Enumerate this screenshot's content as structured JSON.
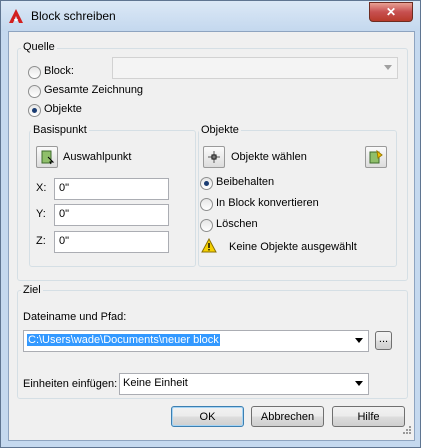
{
  "window": {
    "title": "Block schreiben",
    "close_glyph": "✕"
  },
  "source": {
    "group_label": "Quelle",
    "block_label": "Block:",
    "block_value": "",
    "drawing_label": "Gesamte Zeichnung",
    "objects_label": "Objekte",
    "selected": "Objekte"
  },
  "basepoint": {
    "group_label": "Basispunkt",
    "pick_label": "Auswahlpunkt",
    "x_label": "X:",
    "x_value": "0\"",
    "y_label": "Y:",
    "y_value": "0\"",
    "z_label": "Z:",
    "z_value": "0\""
  },
  "objects": {
    "group_label": "Objekte",
    "select_label": "Objekte wählen",
    "retain_label": "Beibehalten",
    "convert_label": "In Block konvertieren",
    "delete_label": "Löschen",
    "selected": "Beibehalten",
    "warning_text": "Keine Objekte ausgewählt"
  },
  "destination": {
    "group_label": "Ziel",
    "path_label": "Dateiname und Pfad:",
    "path_value": "C:\\Users\\wade\\Documents\\neuer block",
    "browse_label": "...",
    "units_label": "Einheiten einfügen:",
    "units_value": "Keine Einheit"
  },
  "buttons": {
    "ok": "OK",
    "cancel": "Abbrechen",
    "help": "Hilfe"
  },
  "icons": {
    "app": "autocad-logo-icon",
    "pick": "pick-point-icon",
    "select": "select-objects-icon",
    "quickselect": "quick-select-icon",
    "warning": "warning-icon"
  },
  "colors": {
    "selection": "#3399ff",
    "warning": "#f5d000"
  }
}
